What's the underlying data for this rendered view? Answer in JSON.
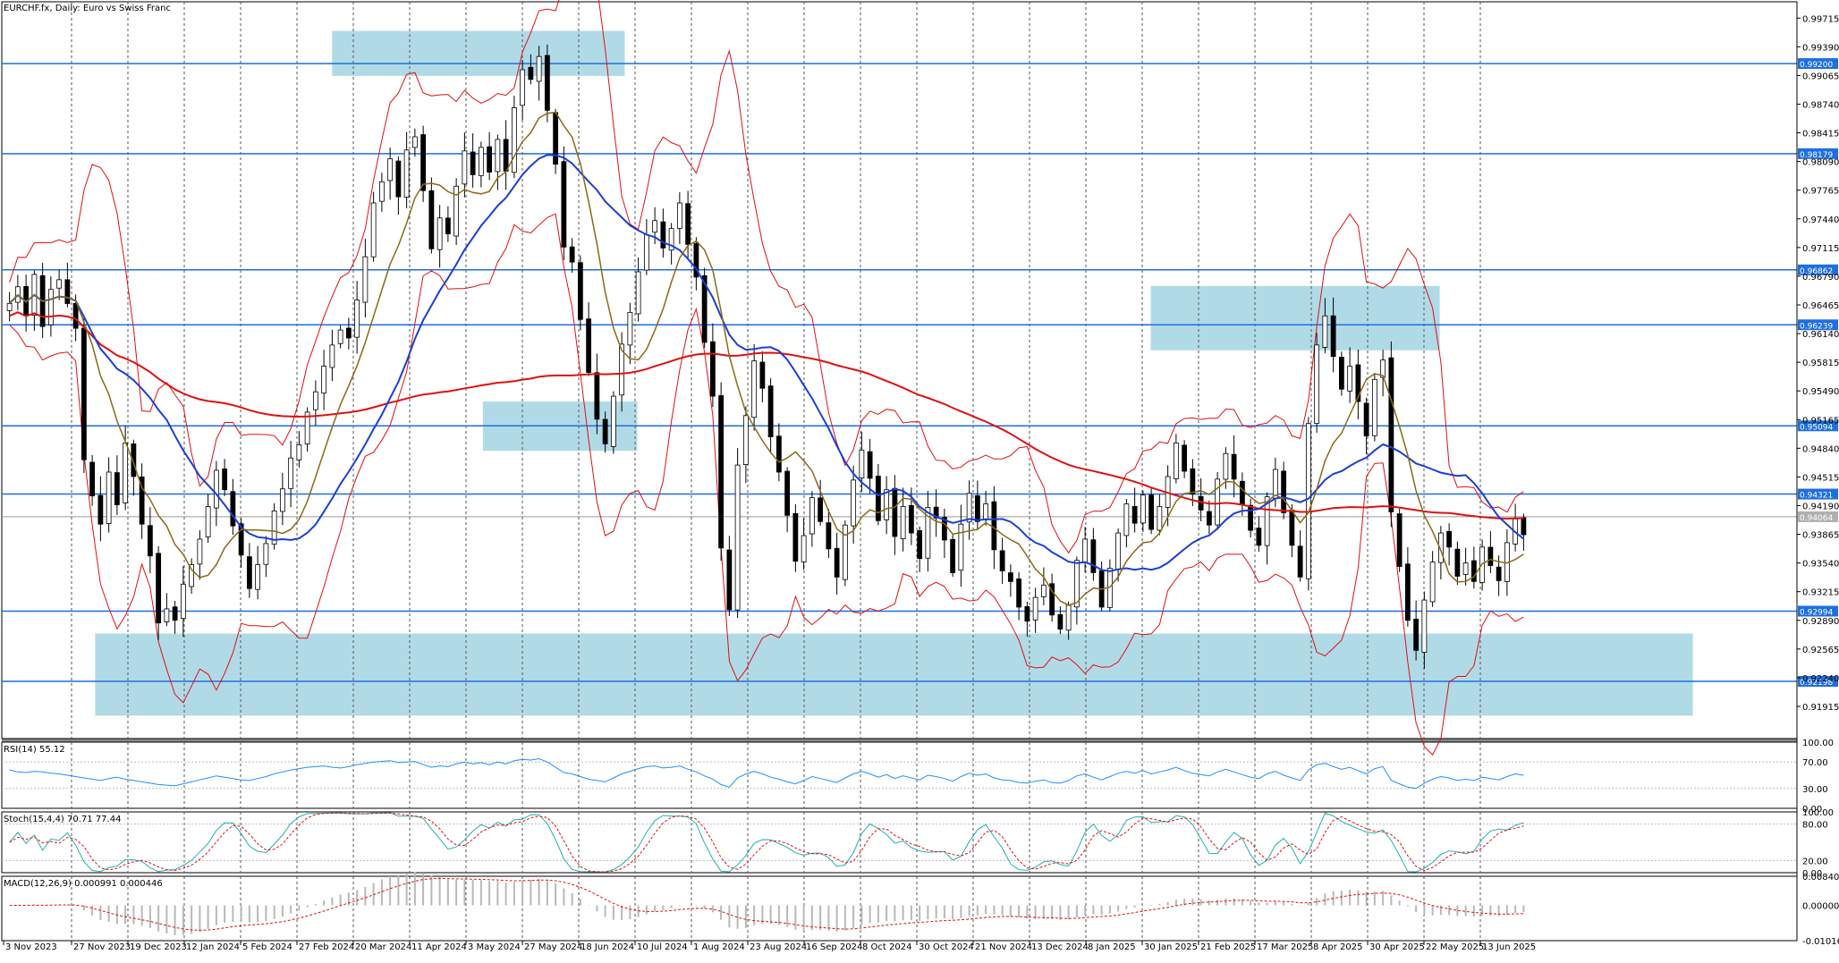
{
  "chart_data": {
    "type": "candlestick",
    "title": "EURCHF.fx, Daily:  Euro vs Swiss Franc",
    "symbol": "EURCHF.fx",
    "timeframe": "Daily",
    "price_axis_ticks": [
      "0.99715",
      "0.99390",
      "0.99065",
      "0.98740",
      "0.98415",
      "0.98090",
      "0.97765",
      "0.97440",
      "0.97115",
      "0.96790",
      "0.96465",
      "0.96140",
      "0.95815",
      "0.95490",
      "0.95165",
      "0.94840",
      "0.94515",
      "0.94190",
      "0.93865",
      "0.93540",
      "0.93215",
      "0.92890",
      "0.92565",
      "0.92240",
      "0.91915"
    ],
    "ylim": [
      0.9155,
      0.999
    ],
    "x_tick_labels": [
      "3 Nov 2023",
      "27 Nov 2023",
      "19 Dec 2023",
      "12 Jan 2024",
      "5 Feb 2024",
      "27 Feb 2024",
      "20 Mar 2024",
      "11 Apr 2024",
      "3 May 2024",
      "27 May 2024",
      "18 Jun 2024",
      "10 Jul 2024",
      "1 Aug 2024",
      "23 Aug 2024",
      "16 Sep 2024",
      "8 Oct 2024",
      "30 Oct 2024",
      "21 Nov 2024",
      "13 Dec 2024",
      "8 Jan 2025",
      "30 Jan 2025",
      "21 Feb 2025",
      "17 Mar 2025",
      "8 Apr 2025",
      "30 Apr 2025",
      "22 May 2025",
      "13 Jun 2025"
    ],
    "horizontal_levels": [
      {
        "value": 0.992,
        "label": "0.99200"
      },
      {
        "value": 0.98179,
        "label": "0.98179"
      },
      {
        "value": 0.96862,
        "label": "0.96862"
      },
      {
        "value": 0.96239,
        "label": "0.96239"
      },
      {
        "value": 0.95094,
        "label": "0.95094"
      },
      {
        "value": 0.94321,
        "label": "0.94321"
      },
      {
        "value": 0.92994,
        "label": "0.92994"
      },
      {
        "value": 0.92198,
        "label": "0.92198"
      }
    ],
    "current_price": {
      "value": 0.94064,
      "label": "0.94064"
    },
    "zones": [
      {
        "x0": 0.184,
        "x1": 0.347,
        "y0": 0.9906,
        "y1": 0.9957
      },
      {
        "x0": 0.64,
        "x1": 0.801,
        "y0": 0.9595,
        "y1": 0.9668
      },
      {
        "x0": 0.268,
        "x1": 0.354,
        "y0": 0.9481,
        "y1": 0.9537
      },
      {
        "x0": 0.052,
        "x1": 0.942,
        "y0": 0.9181,
        "y1": 0.9274
      }
    ],
    "closes": [
      0.9648,
      0.9667,
      0.9635,
      0.9681,
      0.9622,
      0.9664,
      0.9675,
      0.9648,
      0.962,
      0.9471,
      0.943,
      0.9398,
      0.9457,
      0.942,
      0.949,
      0.9452,
      0.9398,
      0.9362,
      0.9286,
      0.9302,
      0.9289,
      0.933,
      0.9352,
      0.9381,
      0.9418,
      0.9459,
      0.9437,
      0.9396,
      0.9363,
      0.9325,
      0.9352,
      0.9376,
      0.9413,
      0.9438,
      0.9473,
      0.9488,
      0.9525,
      0.9548,
      0.9577,
      0.9601,
      0.9618,
      0.9609,
      0.9652,
      0.9701,
      0.9762,
      0.9786,
      0.9812,
      0.9769,
      0.9822,
      0.9837,
      0.9776,
      0.971,
      0.9745,
      0.9727,
      0.9781,
      0.9821,
      0.9794,
      0.9825,
      0.9797,
      0.9834,
      0.9798,
      0.987,
      0.9913,
      0.9902,
      0.9928,
      0.9867,
      0.9806,
      0.9712,
      0.9695,
      0.963,
      0.957,
      0.9517,
      0.9489,
      0.9543,
      0.9602,
      0.9638,
      0.9684,
      0.9726,
      0.9742,
      0.9711,
      0.9733,
      0.9762,
      0.9715,
      0.9678,
      0.9604,
      0.9543,
      0.9371,
      0.9301,
      0.9465,
      0.9521,
      0.9583,
      0.9552,
      0.9497,
      0.9457,
      0.9408,
      0.9356,
      0.9385,
      0.9428,
      0.9401,
      0.937,
      0.9338,
      0.9397,
      0.9448,
      0.9482,
      0.945,
      0.9402,
      0.9437,
      0.9384,
      0.9418,
      0.9388,
      0.9359,
      0.9417,
      0.9405,
      0.938,
      0.9343,
      0.9398,
      0.9433,
      0.9401,
      0.9421,
      0.9369,
      0.9345,
      0.9333,
      0.9304,
      0.9288,
      0.9315,
      0.9329,
      0.9295,
      0.9279,
      0.9306,
      0.9357,
      0.9381,
      0.9343,
      0.9304,
      0.9348,
      0.9388,
      0.9421,
      0.9399,
      0.9431,
      0.9392,
      0.9418,
      0.9452,
      0.949,
      0.9458,
      0.9432,
      0.9414,
      0.9397,
      0.9449,
      0.9478,
      0.9449,
      0.942,
      0.9391,
      0.9374,
      0.9429,
      0.946,
      0.9411,
      0.9374,
      0.9338,
      0.9512,
      0.9601,
      0.9634,
      0.9588,
      0.9551,
      0.9577,
      0.9537,
      0.9498,
      0.9562,
      0.9584,
      0.9412,
      0.935,
      0.9289,
      0.9255,
      0.9312,
      0.9355,
      0.9388,
      0.9372,
      0.9339,
      0.9354,
      0.9333,
      0.9372,
      0.9351,
      0.9334,
      0.9377,
      0.9404,
      0.9386
    ],
    "indicators": {
      "ma_fast_color": "#8b6914",
      "ma_mid_color": "#1a3fd6",
      "ma_slow_color": "#e01010",
      "bollinger_color": "#e01010"
    },
    "rsi": {
      "label": "RSI(14) 55.12",
      "ticks": [
        "100.00",
        "70.00",
        "30.00",
        "0.00"
      ],
      "levels": [
        70,
        30
      ],
      "values": [
        58,
        55,
        54,
        56,
        55,
        53,
        52,
        50,
        48,
        46,
        44,
        42,
        45,
        47,
        44,
        42,
        40,
        38,
        36,
        35,
        34,
        37,
        40,
        43,
        46,
        49,
        47,
        45,
        43,
        42,
        45,
        48,
        52,
        55,
        58,
        60,
        62,
        63,
        64,
        62,
        61,
        63,
        66,
        68,
        70,
        71,
        72,
        69,
        70,
        71,
        66,
        62,
        64,
        63,
        67,
        70,
        67,
        69,
        66,
        70,
        67,
        72,
        74,
        73,
        75,
        70,
        62,
        54,
        52,
        48,
        44,
        42,
        40,
        46,
        52,
        56,
        60,
        63,
        64,
        61,
        62,
        64,
        59,
        55,
        49,
        44,
        36,
        32,
        46,
        52,
        56,
        52,
        47,
        44,
        40,
        37,
        42,
        48,
        45,
        42,
        39,
        46,
        52,
        56,
        52,
        47,
        51,
        45,
        49,
        46,
        43,
        50,
        48,
        45,
        41,
        48,
        53,
        50,
        52,
        46,
        43,
        42,
        39,
        38,
        41,
        43,
        39,
        38,
        42,
        49,
        52,
        47,
        43,
        48,
        53,
        56,
        53,
        57,
        52,
        55,
        58,
        62,
        57,
        53,
        51,
        49,
        55,
        59,
        55,
        51,
        47,
        45,
        52,
        56,
        50,
        46,
        42,
        58,
        66,
        68,
        63,
        59,
        62,
        57,
        52,
        60,
        63,
        42,
        37,
        32,
        30,
        38,
        44,
        48,
        46,
        42,
        44,
        42,
        47,
        45,
        43,
        48,
        52,
        50
      ]
    },
    "stoch": {
      "label": "Stoch(15,4,4) 70.71 77.44",
      "ticks": [
        "100.00",
        "80.00",
        "20.00",
        "0.00"
      ],
      "levels": [
        80,
        20
      ]
    },
    "macd": {
      "label": "MACD(12,26,9) 0.000991 0.000446",
      "ticks": [
        "0.008402",
        "0.000000",
        "-0.010160"
      ]
    }
  }
}
